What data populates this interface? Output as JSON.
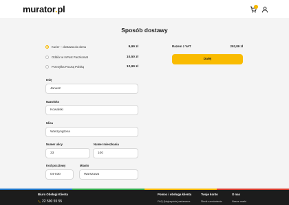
{
  "header": {
    "logo_main": "murator",
    "logo_dot": ".",
    "logo_tld": "pl",
    "cart_count": "1"
  },
  "page": {
    "title": "Sposób dostawy"
  },
  "shipping": {
    "options": [
      {
        "label": "Kurier – dostawa do domu",
        "price": "9,99 zł",
        "selected": true
      },
      {
        "label": "Odbiór w InPost Paczkomat",
        "price": "10,50 zł",
        "selected": false
      },
      {
        "label": "Przesyłka Pocztą Polską",
        "price": "12,99 zł",
        "selected": false
      }
    ]
  },
  "summary": {
    "total_label": "Razem z VAT",
    "total_value": "293,89 zł",
    "pay_button": "Dalej"
  },
  "form": {
    "first_name": {
      "label": "Imię",
      "value": "Janusz"
    },
    "last_name": {
      "label": "Nazwisko",
      "value": "Kowalski"
    },
    "street": {
      "label": "Ulica",
      "value": "Waszyngtona"
    },
    "street_number": {
      "label": "Numer ulicy",
      "value": "33"
    },
    "apartment_number": {
      "label": "Numer mieszkania",
      "value": "100"
    },
    "postal_code": {
      "label": "Kod pocztowy",
      "value": "04-030"
    },
    "city": {
      "label": "Miasto",
      "value": "Warszawa"
    }
  },
  "footer": {
    "customer_service": {
      "title": "Biuro Obsługi Klienta",
      "phone": "22 590 55 55"
    },
    "help": {
      "title": "Pomoc i obsługa klienta",
      "link": "FAQ (Najczęściej zadawane"
    },
    "account": {
      "title": "Twoje konto",
      "link": "Śledź zamówienie"
    },
    "about": {
      "title": "O nas",
      "link": "Nasze marki"
    }
  },
  "colors": {
    "accent": "#f9bb00",
    "footer_bg": "#1c1c1c",
    "page_bg": "#f4f4f4"
  },
  "icons": [
    "cart-icon",
    "user-icon",
    "phone-icon"
  ]
}
